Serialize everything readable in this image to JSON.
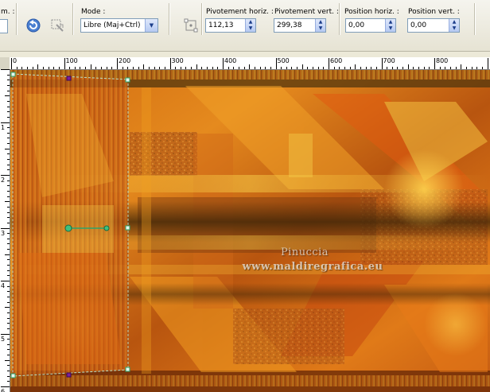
{
  "toolbar": {
    "cut_label": "m. :",
    "mode_label": "Mode :",
    "mode_value": "Libre (Maj+Ctrl)",
    "pivot_h_label": "Pivotement horiz. :",
    "pivot_h_value": "112,13",
    "pivot_v_label": "Pivotement vert. :",
    "pivot_v_value": "299,38",
    "pos_h_label": "Position horiz. :",
    "pos_h_value": "0,00",
    "pos_v_label": "Position vert. :",
    "pos_v_value": "0,00",
    "icons": [
      "reset-icon",
      "apply-transform-icon",
      "pick-tool-icon"
    ]
  },
  "ruler": {
    "labels": [
      "0",
      "100",
      "200",
      "300",
      "400",
      "500",
      "600",
      "700",
      "800"
    ],
    "vertical_labels": [
      "1",
      "2",
      "3",
      "4",
      "5",
      "6"
    ]
  },
  "watermark": {
    "line1": "Pinuccia",
    "line2": "www.maldiregrafica.eu"
  },
  "colors": {
    "handle": "#2da36b",
    "pivot": "#7a1fa0"
  }
}
